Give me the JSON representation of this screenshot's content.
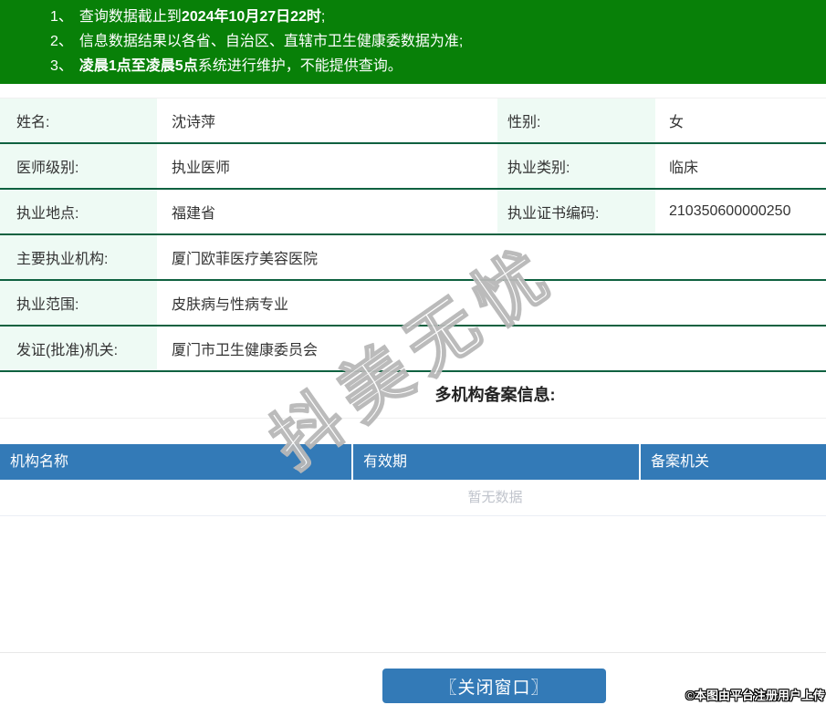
{
  "notice": {
    "items": [
      {
        "num": "1、",
        "pre": "查询数据截止到",
        "bold": "2024年10月27日22时",
        "post": ";"
      },
      {
        "num": "2、",
        "pre": "信息数据结果以各省、自治区、直辖市卫生健康委数据为准;",
        "bold": "",
        "post": ""
      },
      {
        "num": "3、",
        "pre": "",
        "bold": "凌晨1点至凌晨5点",
        "post": "系统进行维护，不能提供查询。"
      }
    ]
  },
  "info": {
    "rows": [
      {
        "label1": "姓名:",
        "value1": "沈诗萍",
        "label2": "性别:",
        "value2": "女"
      },
      {
        "label1": "医师级别:",
        "value1": "执业医师",
        "label2": "执业类别:",
        "value2": "临床"
      },
      {
        "label1": "执业地点:",
        "value1": "福建省",
        "label2": "执业证书编码:",
        "value2": "210350600000250"
      },
      {
        "label1": "主要执业机构:",
        "value1": "厦门欧菲医疗美容医院"
      },
      {
        "label1": "执业范围:",
        "value1": "皮肤病与性病专业"
      },
      {
        "label1": "发证(批准)机关:",
        "value1": "厦门市卫生健康委员会"
      }
    ]
  },
  "multi_org": {
    "title": "多机构备案信息:",
    "columns": [
      "机构名称",
      "有效期",
      "备案机关"
    ],
    "empty_text": "暂无数据"
  },
  "footer": {
    "close_button": "〖关闭窗口〗",
    "copyright": "©本图由平台注册用户上传"
  },
  "watermark_text": "抖美无忧",
  "colors": {
    "banner_green": "#088008",
    "row_border_green": "#0f6140",
    "label_bg_mint": "#eefaf4",
    "table_header_blue": "#337ab7",
    "button_blue": "#337ab7",
    "empty_text_gray": "#c0c4cc"
  }
}
